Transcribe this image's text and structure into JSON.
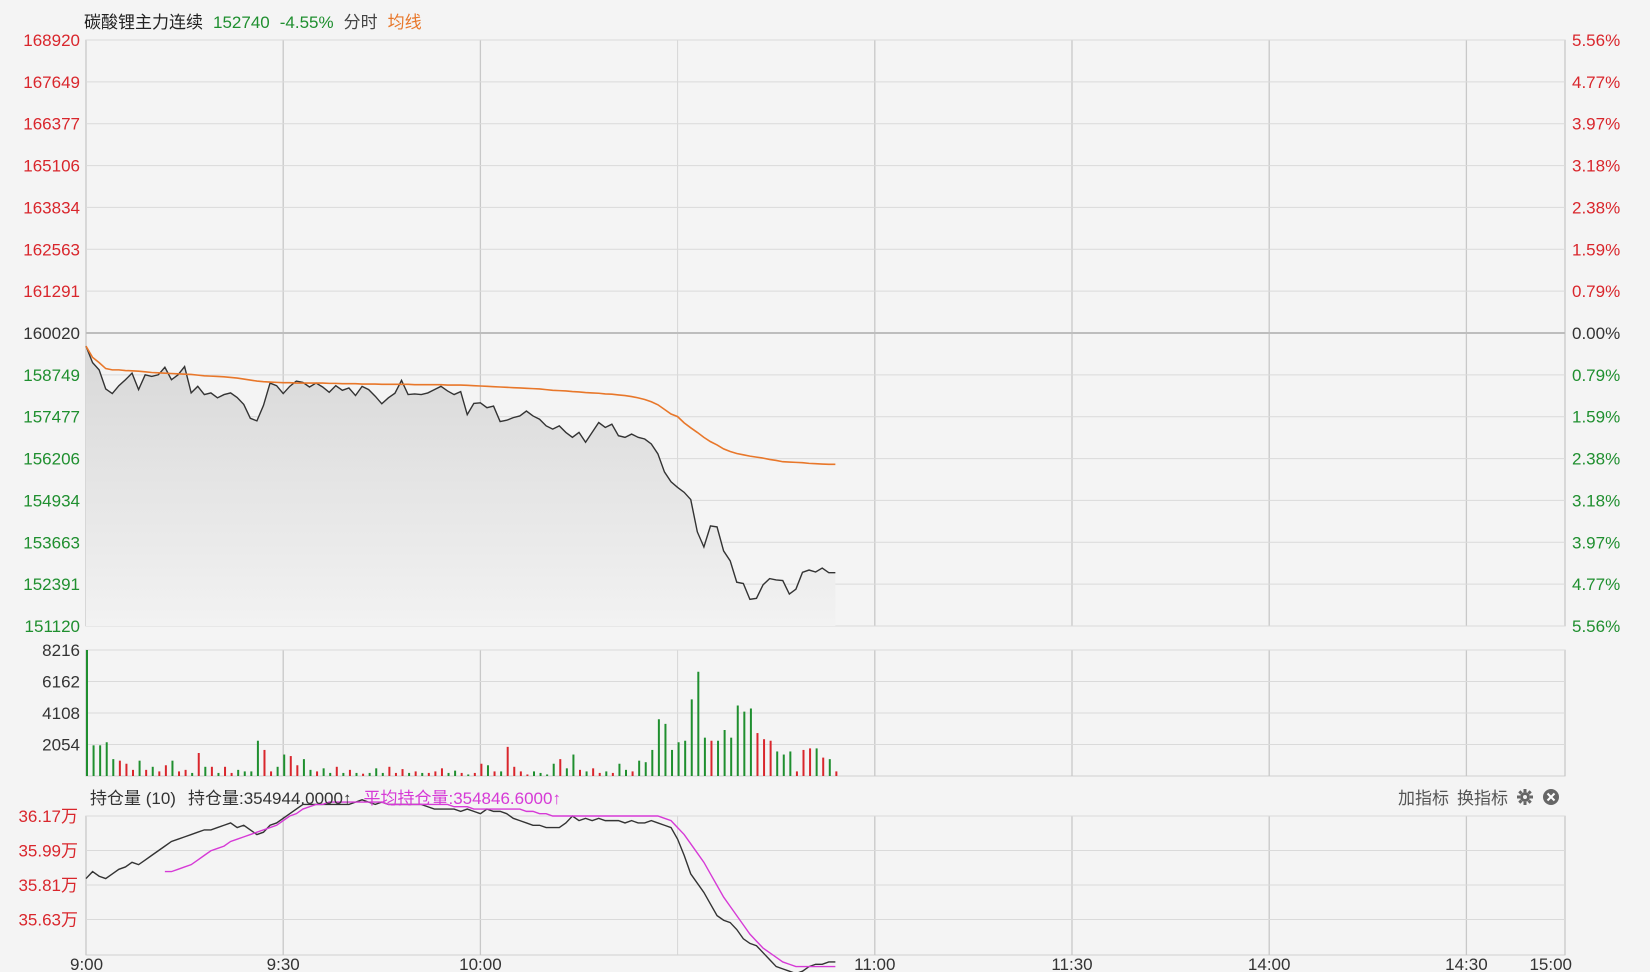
{
  "header": {
    "instrument": "碳酸锂主力连续",
    "price": "152740",
    "change_pct": "-4.55%",
    "mode_label": "分时",
    "avg_label": "均线"
  },
  "colors": {
    "up": "#d9262c",
    "down": "#1f8f2f",
    "price_line": "#333333",
    "avg_line": "#e8772a",
    "oi_avg_line": "#d63ad6",
    "grid": "#cfcfcf"
  },
  "chart_data": [
    {
      "type": "line",
      "name": "price",
      "x_time_labels": [
        "9:00",
        "9:30",
        "10:00",
        "11:00",
        "11:30",
        "14:00",
        "14:30",
        "15:00"
      ],
      "y_left_labels": [
        "168920",
        "167649",
        "166377",
        "165106",
        "163834",
        "162563",
        "161291",
        "160020",
        "158749",
        "157477",
        "156206",
        "154934",
        "153663",
        "152391",
        "151120"
      ],
      "y_right_labels": [
        "5.56%",
        "4.77%",
        "3.97%",
        "3.18%",
        "2.38%",
        "1.59%",
        "0.79%",
        "0.00%",
        "0.79%",
        "1.59%",
        "2.38%",
        "3.18%",
        "3.97%",
        "4.77%",
        "5.56%"
      ],
      "ylim": [
        151120,
        168920
      ],
      "reference_price": 160020,
      "total_minutes": 225,
      "price": [
        159620,
        159120,
        158900,
        158320,
        158180,
        158420,
        158600,
        158800,
        158300,
        158750,
        158700,
        158750,
        158980,
        158600,
        158750,
        159000,
        158200,
        158400,
        158150,
        158200,
        158050,
        158150,
        158200,
        158060,
        157850,
        157430,
        157350,
        157820,
        158500,
        158420,
        158180,
        158400,
        158560,
        158520,
        158380,
        158500,
        158380,
        158220,
        158420,
        158280,
        158350,
        158120,
        158400,
        158300,
        158100,
        157870,
        158050,
        158190,
        158580,
        158150,
        158170,
        158150,
        158200,
        158300,
        158400,
        158260,
        158150,
        158240,
        157540,
        157880,
        157900,
        157750,
        157800,
        157330,
        157370,
        157450,
        157500,
        157650,
        157500,
        157400,
        157200,
        157100,
        157200,
        157000,
        156850,
        157000,
        156700,
        157000,
        157300,
        157150,
        157250,
        156900,
        156850,
        156950,
        156850,
        156800,
        156650,
        156350,
        155800,
        155500,
        155330,
        155180,
        154960,
        153980,
        153520,
        154160,
        154130,
        153400,
        153100,
        152450,
        152410,
        151930,
        151960,
        152370,
        152560,
        152520,
        152500,
        152090,
        152240,
        152750,
        152820,
        152760,
        152880,
        152740,
        152740
      ],
      "avg": [
        159620,
        159280,
        159120,
        158940,
        158900,
        158900,
        158880,
        158870,
        158860,
        158840,
        158820,
        158810,
        158800,
        158790,
        158780,
        158770,
        158760,
        158740,
        158720,
        158710,
        158700,
        158690,
        158670,
        158650,
        158620,
        158590,
        158560,
        158540,
        158530,
        158520,
        158510,
        158510,
        158500,
        158500,
        158500,
        158500,
        158500,
        158490,
        158490,
        158480,
        158480,
        158480,
        158470,
        158470,
        158470,
        158460,
        158460,
        158460,
        158460,
        158460,
        158450,
        158450,
        158450,
        158450,
        158450,
        158440,
        158440,
        158440,
        158430,
        158420,
        158410,
        158400,
        158390,
        158380,
        158370,
        158360,
        158350,
        158340,
        158330,
        158320,
        158300,
        158280,
        158270,
        158260,
        158240,
        158230,
        158210,
        158200,
        158190,
        158170,
        158160,
        158140,
        158120,
        158090,
        158050,
        158000,
        157930,
        157840,
        157700,
        157560,
        157480,
        157290,
        157140,
        157000,
        156850,
        156720,
        156620,
        156500,
        156420,
        156360,
        156320,
        156280,
        156250,
        156220,
        156180,
        156150,
        156110,
        156100,
        156090,
        156080,
        156060,
        156050,
        156040,
        156030,
        156030
      ],
      "volume": [
        8216,
        2000,
        2000,
        2200,
        1100,
        1000,
        800,
        400,
        1000,
        400,
        600,
        300,
        700,
        1000,
        300,
        400,
        200,
        1500,
        600,
        600,
        200,
        600,
        200,
        400,
        300,
        300,
        2300,
        1700,
        300,
        600,
        1400,
        1300,
        700,
        1100,
        400,
        300,
        500,
        200,
        600,
        200,
        400,
        200,
        150,
        200,
        500,
        200,
        600,
        200,
        450,
        200,
        300,
        200,
        200,
        300,
        500,
        200,
        350,
        200,
        100,
        200,
        800,
        700,
        300,
        300,
        1900,
        600,
        300,
        100,
        300,
        200,
        100,
        800,
        1100,
        500,
        1400,
        400,
        300,
        500,
        200,
        300,
        200,
        800,
        400,
        300,
        1000,
        900,
        1700,
        3700,
        3400,
        1700,
        2200,
        2300,
        5000,
        6800,
        2500,
        2300,
        2300,
        3000,
        2500,
        4600,
        4200,
        4400,
        2800,
        2400,
        2300,
        1600,
        1400,
        1600,
        300,
        1700,
        1800,
        1800,
        1200,
        1100,
        300
      ],
      "volume_ylim": [
        0,
        8216
      ],
      "volume_labels": [
        "8216",
        "6162",
        "4108",
        "2054"
      ],
      "oi_labels": [
        "36.17万",
        "35.99万",
        "35.81万",
        "35.63万"
      ],
      "oi_ylim": [
        355650,
        356250
      ],
      "oi": [
        355980,
        356010,
        355990,
        355980,
        356000,
        356020,
        356030,
        356050,
        356040,
        356060,
        356080,
        356100,
        356120,
        356140,
        356150,
        356160,
        356170,
        356180,
        356190,
        356190,
        356200,
        356210,
        356220,
        356200,
        356210,
        356190,
        356170,
        356180,
        356210,
        356220,
        356240,
        356260,
        356280,
        356300,
        356300,
        356300,
        356300,
        356300,
        356300,
        356300,
        356300,
        356310,
        356320,
        356310,
        356300,
        356310,
        356300,
        356300,
        356300,
        356300,
        356300,
        356300,
        356290,
        356280,
        356280,
        356280,
        356280,
        356270,
        356280,
        356270,
        356260,
        356280,
        356270,
        356270,
        356260,
        356240,
        356230,
        356220,
        356210,
        356210,
        356200,
        356200,
        356200,
        356220,
        356250,
        356230,
        356240,
        356230,
        356240,
        356230,
        356230,
        356230,
        356220,
        356230,
        356220,
        356220,
        356230,
        356220,
        356210,
        356200,
        356150,
        356080,
        356000,
        355960,
        355920,
        355870,
        355820,
        355800,
        355790,
        355760,
        355720,
        355700,
        355690,
        355660,
        355630,
        355600,
        355590,
        355580,
        355570,
        355580,
        355600,
        355610,
        355610,
        355620,
        355620
      ],
      "oi_avg": [
        null,
        null,
        null,
        null,
        null,
        null,
        null,
        null,
        null,
        null,
        null,
        null,
        356010,
        356010,
        356020,
        356030,
        356040,
        356060,
        356080,
        356100,
        356110,
        356120,
        356140,
        356150,
        356160,
        356170,
        356180,
        356190,
        356200,
        356210,
        356230,
        356250,
        356260,
        356280,
        356290,
        356300,
        356300,
        356310,
        356310,
        356310,
        356310,
        356310,
        356310,
        356310,
        356310,
        356310,
        356300,
        356300,
        356300,
        356300,
        356300,
        356300,
        356300,
        356300,
        356300,
        356300,
        356290,
        356290,
        356290,
        356280,
        356280,
        356280,
        356280,
        356280,
        356280,
        356280,
        356280,
        356270,
        356270,
        356260,
        356260,
        356250,
        356250,
        356250,
        356250,
        356250,
        356250,
        356250,
        356250,
        356250,
        356250,
        356250,
        356250,
        356250,
        356250,
        356250,
        356250,
        356250,
        356240,
        356230,
        356200,
        356170,
        356130,
        356090,
        356050,
        356000,
        355950,
        355900,
        355860,
        355820,
        355780,
        355740,
        355710,
        355680,
        355660,
        355640,
        355620,
        355610,
        355600,
        355600,
        355600,
        355600,
        355600,
        355600,
        355600
      ]
    }
  ],
  "oi_panel": {
    "indicator_name": "持仓量 (10)",
    "oi_label": "持仓量:354944.0000",
    "oi_arrow": "↑",
    "avg_label": "平均持仓量:354846.6000",
    "avg_arrow": "↑",
    "add_indicator": "加指标",
    "switch_indicator": "换指标",
    "settings_icon": "gear-icon",
    "close_icon": "close-circle-icon"
  }
}
